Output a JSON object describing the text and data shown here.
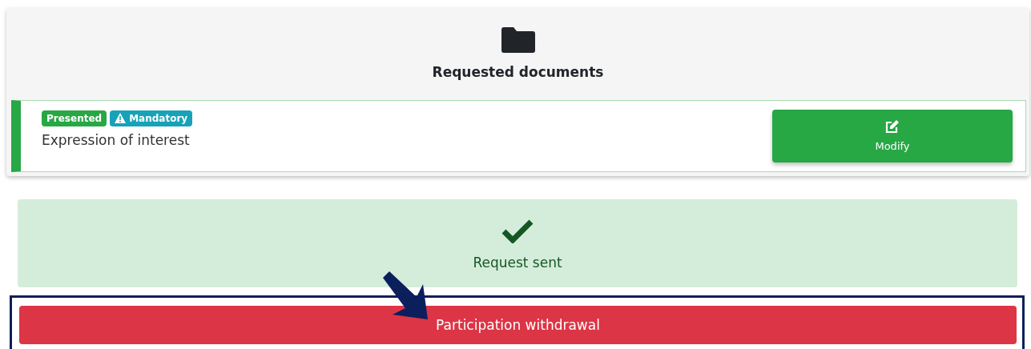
{
  "card": {
    "title": "Requested documents",
    "documents": [
      {
        "badges": [
          {
            "kind": "status",
            "label": "Presented"
          },
          {
            "kind": "warning",
            "label": "Mandatory"
          }
        ],
        "name": "Expression of interest",
        "button": "Modify"
      }
    ]
  },
  "alert": {
    "message": "Request sent"
  },
  "action": {
    "label": "Participation withdrawal",
    "highlighted": true
  }
}
